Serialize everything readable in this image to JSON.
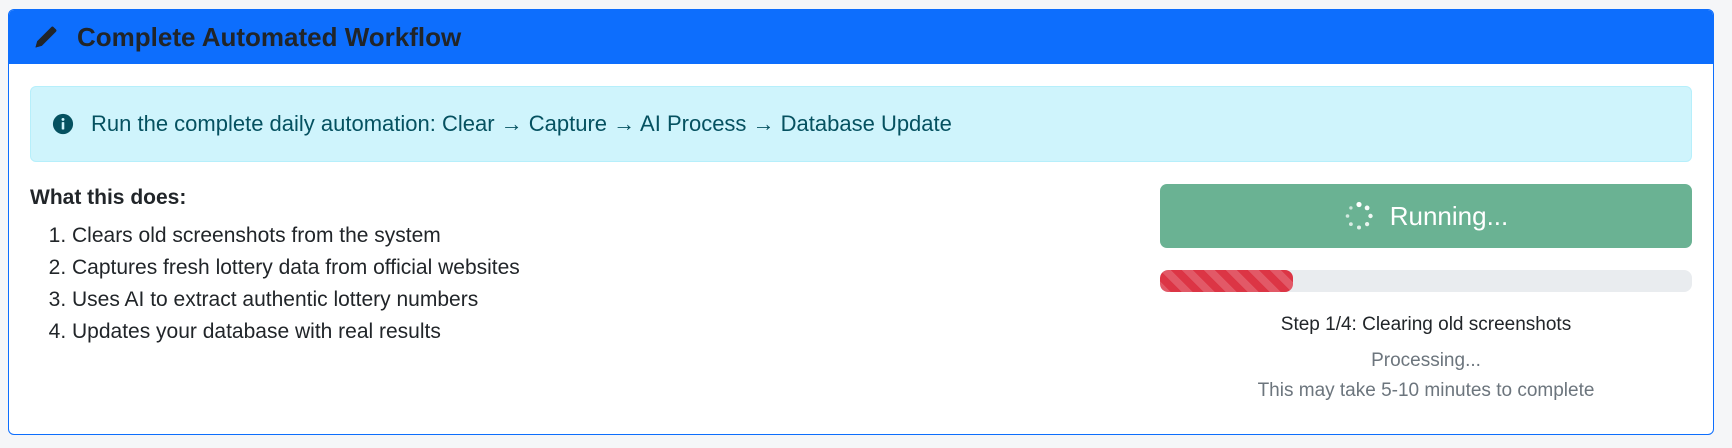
{
  "header": {
    "title": "Complete Automated Workflow",
    "icon": "pencil-icon"
  },
  "alert": {
    "icon": "info-circle-icon",
    "text": "Run the complete daily automation: Clear → Capture → AI Process → Database Update"
  },
  "description": {
    "heading": "What this does:",
    "steps": [
      "Clears old screenshots from the system",
      "Captures fresh lottery data from official websites",
      "Uses AI to extract authentic lottery numbers",
      "Updates your database with real results"
    ]
  },
  "action": {
    "button_label": "Running...",
    "button_color": "#6ab293",
    "progress_percent": 25,
    "progress_color": "#dc3545",
    "step_text": "Step 1/4: Clearing old screenshots",
    "processing_text": "Processing...",
    "note_text": "This may take 5-10 minutes to complete"
  },
  "colors": {
    "header_bg": "#0d6efd",
    "alert_bg": "#cff4fc",
    "alert_text": "#055160"
  }
}
